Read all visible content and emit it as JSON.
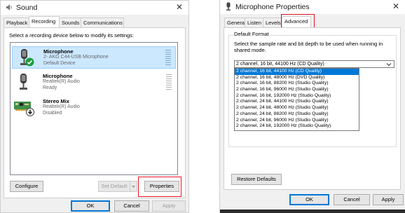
{
  "sound": {
    "title": "Sound",
    "tabs": [
      {
        "label": "Playback"
      },
      {
        "label": "Recording"
      },
      {
        "label": "Sounds"
      },
      {
        "label": "Communications"
      }
    ],
    "instruction": "Select a recording device below to modify its settings:",
    "devices": [
      {
        "name": "Microphone",
        "line1": "2- AKG C44-USB Microphone",
        "line2": "Default Device",
        "selected": true,
        "icon": "microphone-icon",
        "badge": "checkmark-icon"
      },
      {
        "name": "Microphone",
        "line1": "Realtek(R) Audio",
        "line2": "Ready",
        "selected": false,
        "icon": "microphone-icon"
      },
      {
        "name": "Stereo Mix",
        "line1": "Realtek(R) Audio",
        "line2": "Disabled",
        "selected": false,
        "icon": "sound-card-icon",
        "badge": "disabled-arrow-icon"
      }
    ],
    "buttons": {
      "configure": "Configure",
      "set_default": "Set Default",
      "properties": "Properties",
      "ok": "OK",
      "cancel": "Cancel",
      "apply": "Apply"
    }
  },
  "mic_props": {
    "title": "Microphone Properties",
    "tabs": [
      {
        "label": "General"
      },
      {
        "label": "Listen"
      },
      {
        "label": "Levels"
      },
      {
        "label": "Advanced"
      }
    ],
    "default_format": {
      "group_label": "Default Format",
      "description": "Select the sample rate and bit depth to be used when running in shared mode.",
      "selected": "2 channel, 16 bit, 44100 Hz (CD Quality)",
      "options": [
        "2 channel, 16 bit, 44100 Hz (CD Quality)",
        "2 channel, 16 bit, 48000 Hz (DVD Quality)",
        "2 channel, 16 bit, 88200 Hz (Studio Quality)",
        "2 channel, 16 bit, 96000 Hz (Studio Quality)",
        "2 channel, 16 bit, 192000 Hz (Studio Quality)",
        "2 channel, 24 bit, 44100 Hz (Studio Quality)",
        "2 channel, 24 bit, 48000 Hz (Studio Quality)",
        "2 channel, 24 bit, 88200 Hz (Studio Quality)",
        "2 channel, 24 bit, 96000 Hz (Studio Quality)",
        "2 channel, 24 bit, 192000 Hz (Studio Quality)"
      ]
    },
    "buttons": {
      "restore": "Restore Defaults",
      "ok": "OK",
      "cancel": "Cancel",
      "apply": "Apply"
    }
  },
  "colors": {
    "highlight_box": "#e81123",
    "selection": "#cce8ff",
    "list_highlight": "#0078d7"
  }
}
